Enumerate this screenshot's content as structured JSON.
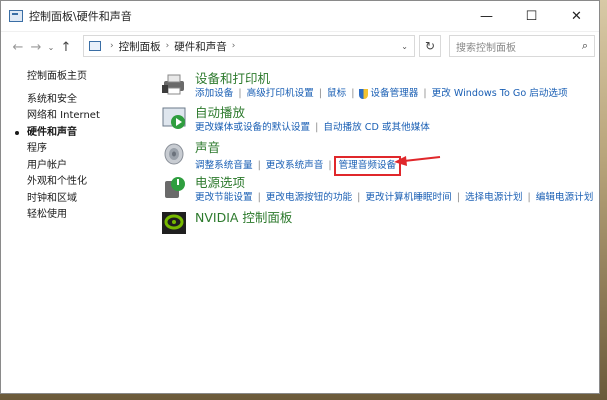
{
  "window": {
    "title": "控制面板\\硬件和声音"
  },
  "window_buttons": {
    "minimize": "—",
    "maximize": "☐",
    "close": "✕"
  },
  "nav": {
    "back": "←",
    "forward": "→",
    "dropdown": "⌄",
    "up": "↑",
    "breadcrumb": [
      "控制面板",
      "硬件和声音"
    ],
    "refresh": "↻",
    "search_placeholder": "搜索控制面板"
  },
  "sidebar": {
    "items": [
      "控制面板主页",
      "系统和安全",
      "网络和 Internet",
      "硬件和声音",
      "程序",
      "用户帐户",
      "外观和个性化",
      "时钟和区域",
      "轻松使用"
    ],
    "current_index": 3
  },
  "categories": [
    {
      "title": "设备和打印机",
      "icon": "printer-icon",
      "links": [
        "添加设备",
        "高级打印机设置",
        "鼠标",
        "设备管理器",
        "更改 Windows To Go 启动选项"
      ]
    },
    {
      "title": "自动播放",
      "icon": "autoplay-icon",
      "links": [
        "更改媒体或设备的默认设置",
        "自动播放 CD 或其他媒体"
      ]
    },
    {
      "title": "声音",
      "icon": "speaker-icon",
      "links": [
        "调整系统音量",
        "更改系统声音",
        "管理音频设备"
      ],
      "highlighted_link_index": 2
    },
    {
      "title": "电源选项",
      "icon": "power-icon",
      "links": [
        "更改节能设置",
        "更改电源按钮的功能",
        "更改计算机睡眠时间",
        "选择电源计划",
        "编辑电源计划"
      ]
    },
    {
      "title": "NVIDIA 控制面板",
      "icon": "nvidia-icon",
      "links": []
    }
  ],
  "colors": {
    "link": "#1a5fb4",
    "category_title": "#2d7a2d",
    "annotation": "#e0272b"
  }
}
